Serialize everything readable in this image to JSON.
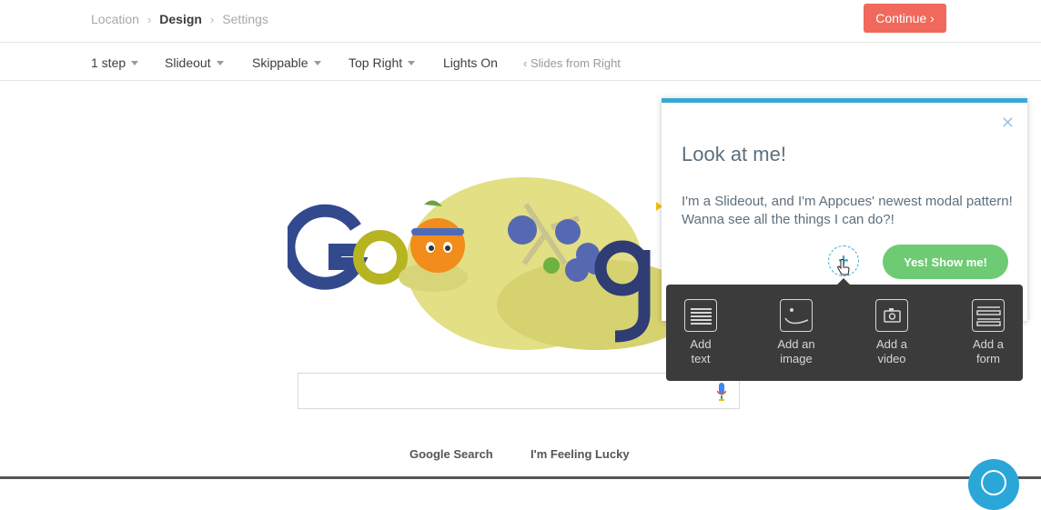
{
  "breadcrumb": {
    "items": [
      "Location",
      "Design",
      "Settings"
    ],
    "active_index": 1
  },
  "continue_label": "Continue ›",
  "options": {
    "steps": "1 step",
    "type": "Slideout",
    "skippable": "Skippable",
    "position": "Top Right",
    "lights": "Lights On",
    "animation": "‹ Slides from Right"
  },
  "google": {
    "search_button": "Google Search",
    "lucky_button": "I'm Feeling Lucky"
  },
  "modal": {
    "close": "✕",
    "title": "Look at me!",
    "body": "I'm a Slideout, and I'm Appcues' newest modal pattern! Wanna see all the things I can do?!",
    "plus": "+",
    "cta": "Yes! Show me!"
  },
  "tools": [
    {
      "label_line1": "Add",
      "label_line2": "text"
    },
    {
      "label_line1": "Add an",
      "label_line2": "image"
    },
    {
      "label_line1": "Add a",
      "label_line2": "video"
    },
    {
      "label_line1": "Add a",
      "label_line2": "form"
    }
  ],
  "colors": {
    "accent_blue": "#3aa9d2",
    "continue_red": "#f0695c",
    "cta_green": "#6ecb74",
    "tooltip_bg": "#3b3b3b"
  }
}
